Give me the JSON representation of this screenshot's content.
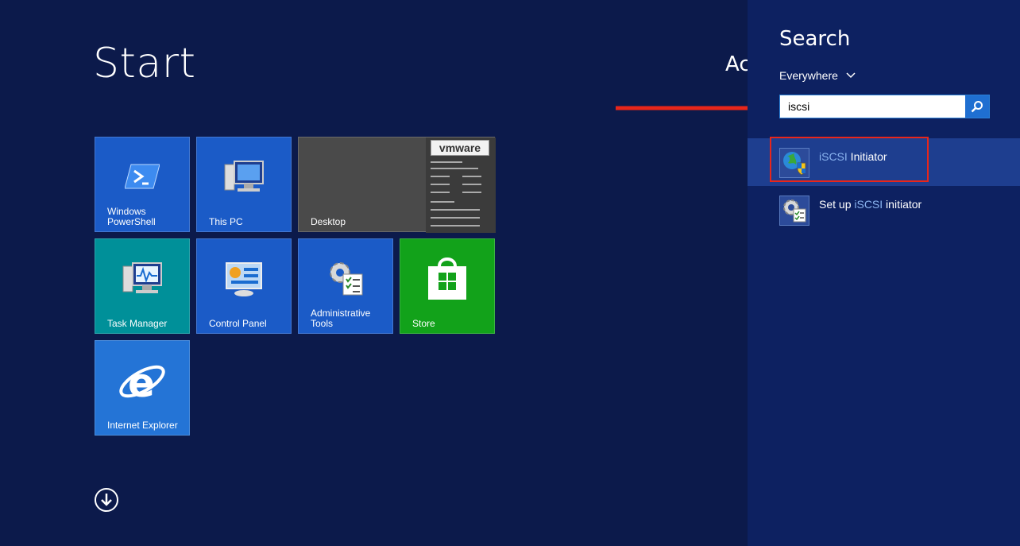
{
  "start": {
    "title": "Start",
    "account_partial": "Ac"
  },
  "tiles": {
    "powershell": "Windows\nPowerShell",
    "this_pc": "This PC",
    "desktop": "Desktop",
    "desktop_logo": "vmware",
    "task_manager": "Task Manager",
    "control_panel": "Control Panel",
    "admin_tools": "Administrative\nTools",
    "store": "Store",
    "ie": "Internet Explorer"
  },
  "search": {
    "title": "Search",
    "scope": "Everywhere",
    "query": "iscsi",
    "results": [
      {
        "prefix": "",
        "match": "iSCSI",
        "suffix": " Initiator"
      },
      {
        "prefix": "Set up ",
        "match": "iSCSI",
        "suffix": " initiator"
      }
    ]
  },
  "colors": {
    "background": "#0c1a4b",
    "charm": "#0d2161",
    "highlight_box": "#e8261a",
    "arrow": "#e8261a"
  }
}
